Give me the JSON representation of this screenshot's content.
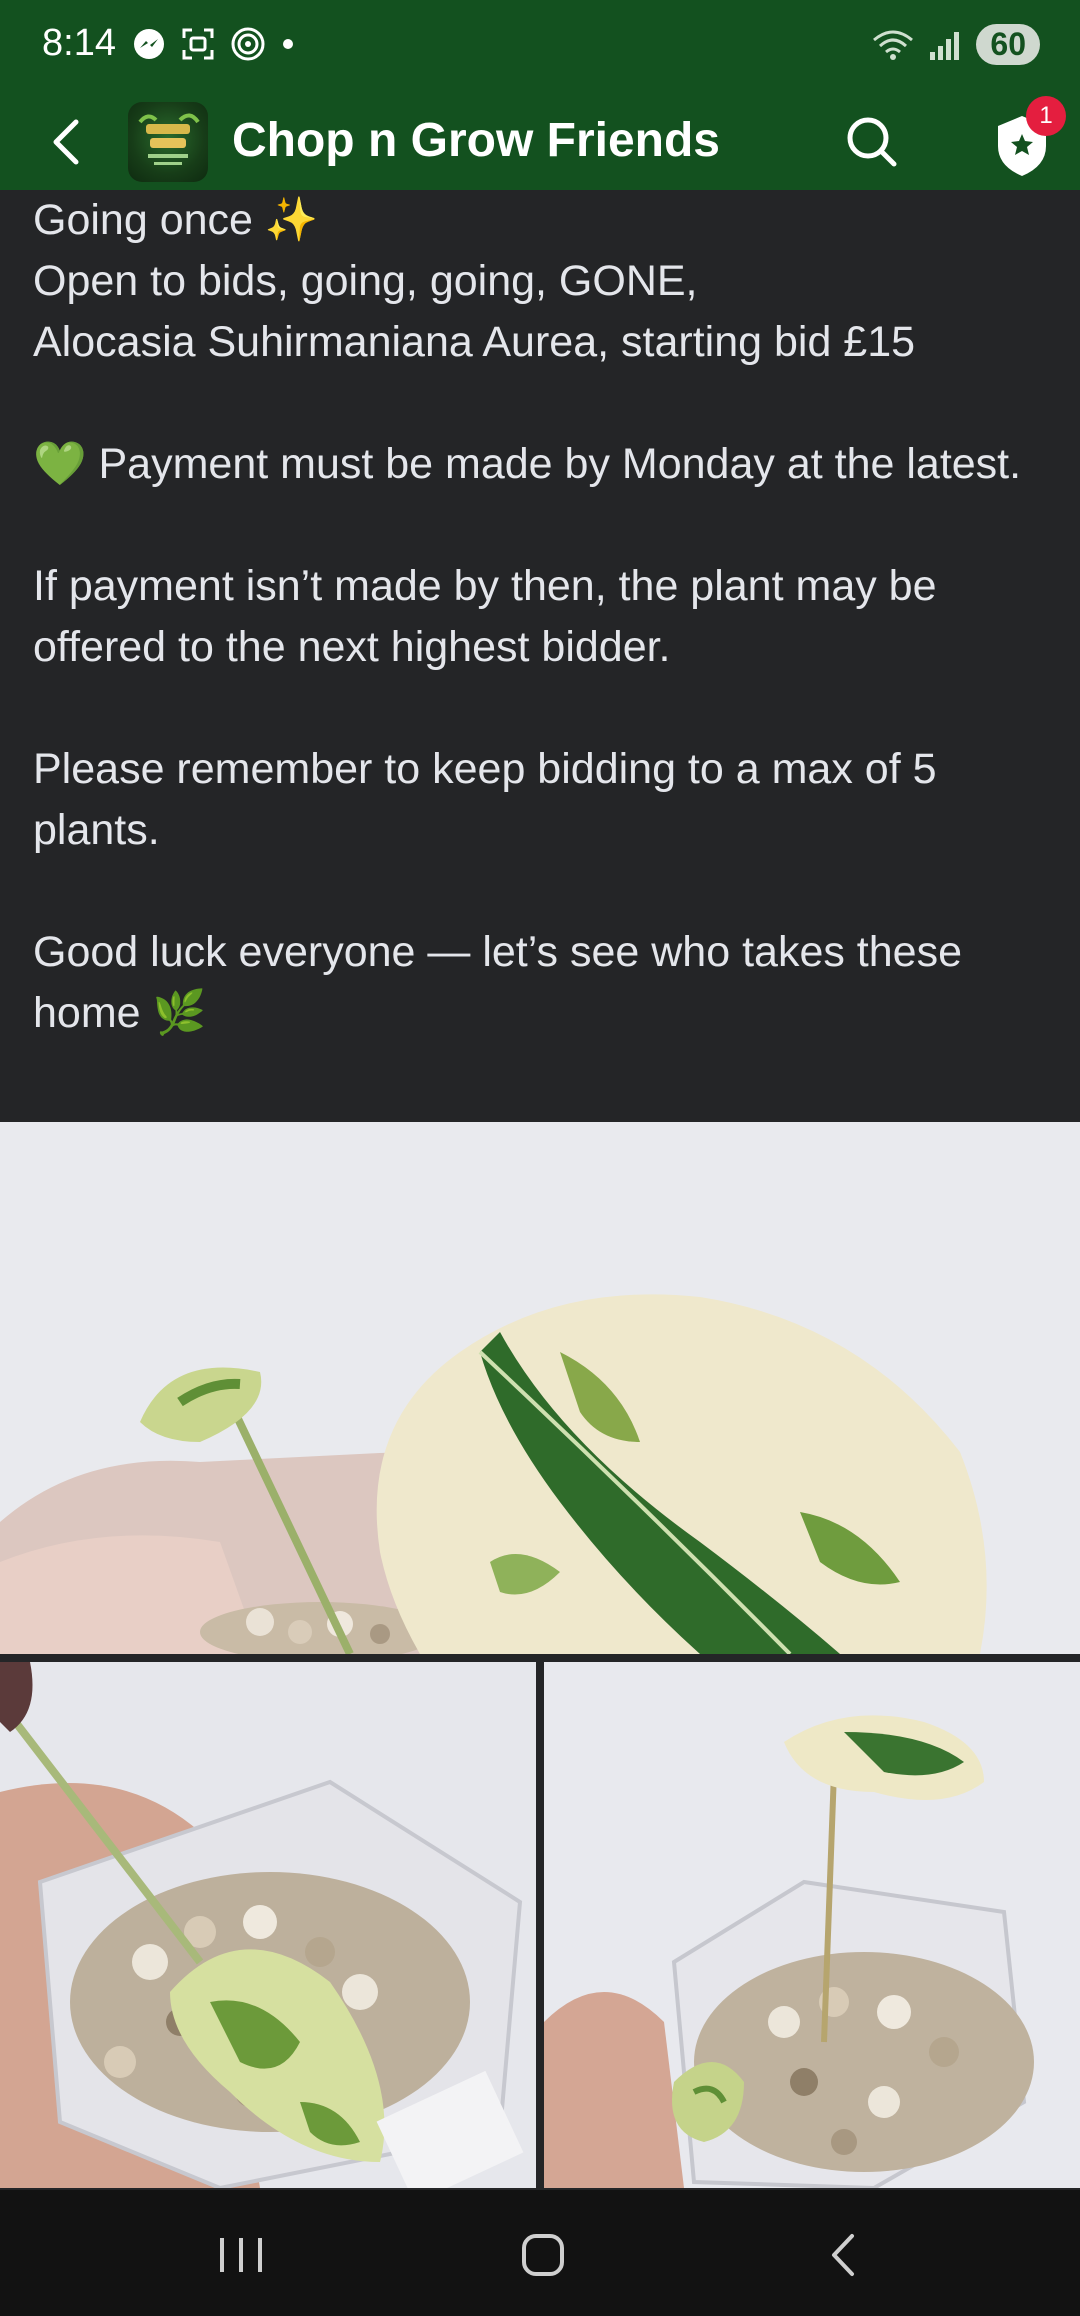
{
  "status_bar": {
    "time": "8:14",
    "battery": "60",
    "left_icons": [
      "messenger-icon",
      "screenshot-icon",
      "nfc-icon",
      "dot-icon"
    ],
    "right_icons": [
      "wifi-icon",
      "signal-icon"
    ]
  },
  "app_bar": {
    "group_name": "Chop n Grow Friends",
    "notification_count": "1",
    "brand_color": "#13511f"
  },
  "post": {
    "lines": [
      "Going once ✨",
      "Open to bids, going, going, GONE,",
      "Alocasia Suhirmaniana Aurea, starting bid £15",
      "",
      "💚 Payment must be made by Monday at the latest.",
      "",
      "If payment isn’t made by then, the plant may be offered to the next highest bidder.",
      "",
      "Please remember to keep bidding to a max of 5 plants.",
      "",
      "Good luck everyone — let’s see who takes these home 🌿"
    ]
  },
  "photos": {
    "pot_label": "Alocasia Suhirmaniana Aurea"
  }
}
